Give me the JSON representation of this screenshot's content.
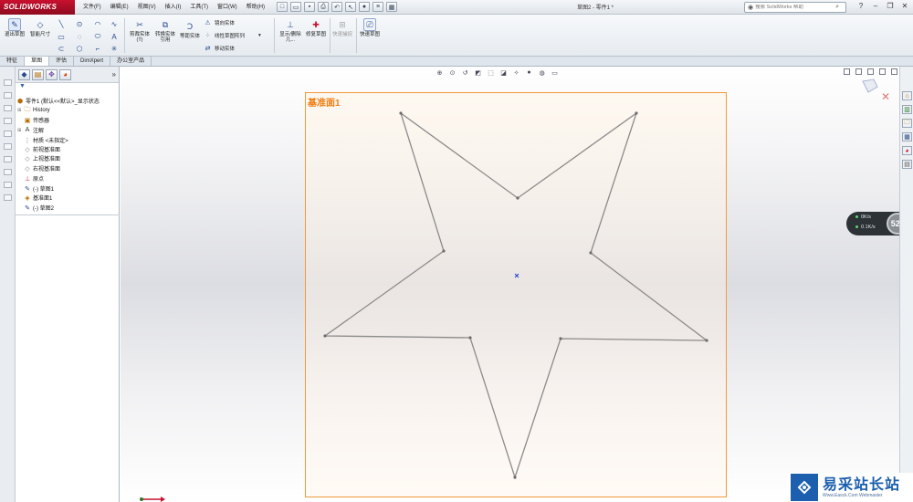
{
  "app": {
    "logo_text": "SOLIDWORKS",
    "document_title": "草图2 - 零件1 *"
  },
  "menu": {
    "items": [
      "文件(F)",
      "编辑(E)",
      "视图(V)",
      "插入(I)",
      "工具(T)",
      "窗口(W)",
      "帮助(H)"
    ]
  },
  "search": {
    "placeholder": "搜索 SolidWorks 帮助"
  },
  "ribbon": {
    "exit_sketch": "退出草图",
    "smart_dimension": "智能尺寸",
    "trim": "剪裁实体(T)",
    "convert": "转换实体引用",
    "offset": "等距实体",
    "mirror": "镜向实体",
    "linear_pattern": "线性草图阵列",
    "move": "移动实体",
    "display_delete": "显示/删除几...",
    "repair": "修复草图",
    "quick_snaps": "快速捕捉",
    "rapid_sketch": "快速草图"
  },
  "ribbon_tabs": [
    "特征",
    "草图",
    "评估",
    "DimXpert",
    "办公室产品"
  ],
  "ribbon_tab_active": 1,
  "feature_tree": {
    "root": "零件1 (默认<<默认>_显示状态",
    "items": [
      "History",
      "传感器",
      "注解",
      "材质 <未指定>",
      "前视基准面",
      "上视基准面",
      "右视基准面",
      "原点",
      "(-) 草图1",
      "基准面1",
      "(-) 草图2"
    ]
  },
  "graphics": {
    "plane_label": "基准面1",
    "star_points": [
      [
        104,
        22
      ],
      [
        232,
        115
      ],
      [
        362,
        22
      ],
      [
        312,
        175
      ],
      [
        439,
        271
      ],
      [
        279,
        269
      ],
      [
        229,
        421
      ],
      [
        180,
        268
      ],
      [
        21,
        266
      ],
      [
        151,
        173
      ]
    ],
    "center_point": [
      231,
      200
    ],
    "line_color": "#8b8b8b",
    "plane_border_color": "#f29a3a"
  },
  "performance": {
    "upload": "0K/s",
    "download": "0.1K/s",
    "percent": "52",
    "percent_unit": "%"
  },
  "watermark": {
    "main": "易采站长站",
    "sub": "Www.Easck.Com Webmaster"
  }
}
